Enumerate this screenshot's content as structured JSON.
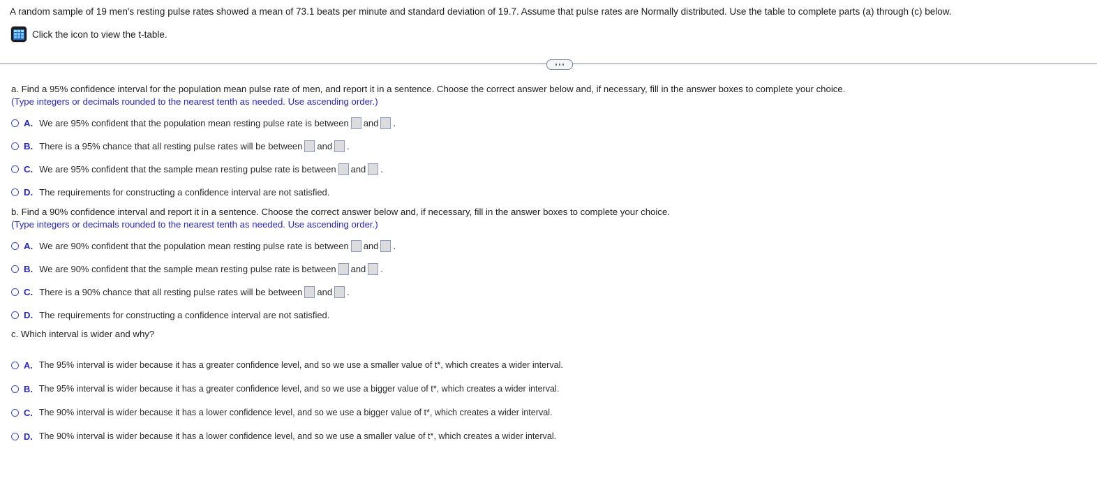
{
  "stem": "A random sample of 19 men's resting pulse rates showed a mean of 73.1 beats per minute and standard deviation of 19.7. Assume that pulse rates are Normally distributed. Use the table to complete parts (a) through (c) below.",
  "ttable": {
    "icon": "table-icon",
    "label": "Click the icon to view the t-table."
  },
  "divider": {
    "icon": "ellipsis-icon"
  },
  "colors": {
    "hint_blue": "#2727c4",
    "letter_blue": "#2727c4",
    "radio_blue": "#3f4fc4",
    "body_text": "#1c1c1c",
    "answer_box_fill": "#dcdcdc",
    "answer_box_border": "#8c9bc6",
    "divider": "#7b849b",
    "icon_blue": "#1769d6"
  },
  "parts": [
    {
      "id": "a",
      "prompt": "a. Find a 95% confidence interval for the population mean pulse rate of men, and report it in a sentence. Choose the correct answer below and, if necessary, fill in the answer boxes to complete your choice.",
      "hint": "(Type integers or decimals rounded to the nearest tenth as needed. Use ascending order.)",
      "options": [
        {
          "letter": "A.",
          "pre": "We are 95% confident that the population mean resting pulse rate is between",
          "mid": "and",
          "post": ".",
          "boxes": 2,
          "box1_value": "",
          "box2_value": ""
        },
        {
          "letter": "B.",
          "pre": "There is a 95% chance that all resting pulse rates will be between",
          "mid": "and",
          "post": ".",
          "boxes": 2,
          "box1_value": "",
          "box2_value": ""
        },
        {
          "letter": "C.",
          "pre": "We are 95% confident that the sample mean resting pulse rate is between",
          "mid": "and",
          "post": ".",
          "boxes": 2,
          "box1_value": "",
          "box2_value": ""
        },
        {
          "letter": "D.",
          "pre": "The requirements for constructing a confidence interval are not satisfied.",
          "mid": "",
          "post": "",
          "boxes": 0,
          "box1_value": "",
          "box2_value": ""
        }
      ]
    },
    {
      "id": "b",
      "prompt": "b. Find a 90% confidence interval and report it in a sentence. Choose the correct answer below and, if necessary, fill in the answer boxes to complete your choice.",
      "hint": "(Type integers or decimals rounded to the nearest tenth as needed. Use ascending order.)",
      "options": [
        {
          "letter": "A.",
          "pre": "We are 90% confident that the population mean resting pulse rate is between",
          "mid": "and",
          "post": ".",
          "boxes": 2,
          "box1_value": "",
          "box2_value": ""
        },
        {
          "letter": "B.",
          "pre": "We are 90% confident that the sample mean resting pulse rate is between",
          "mid": "and",
          "post": ".",
          "boxes": 2,
          "box1_value": "",
          "box2_value": ""
        },
        {
          "letter": "C.",
          "pre": "There is a 90% chance that all resting pulse rates will be between",
          "mid": "and",
          "post": ".",
          "boxes": 2,
          "box1_value": "",
          "box2_value": ""
        },
        {
          "letter": "D.",
          "pre": "The requirements for constructing a confidence interval are not satisfied.",
          "mid": "",
          "post": "",
          "boxes": 0,
          "box1_value": "",
          "box2_value": ""
        }
      ]
    },
    {
      "id": "c",
      "prompt": "c. Which interval is wider and why?",
      "hint": "",
      "options": [
        {
          "letter": "A.",
          "pre": "The 95% interval is wider because it has a greater confidence level, and so we use a smaller value of t*, which creates a wider interval.",
          "mid": "",
          "post": "",
          "boxes": 0,
          "box1_value": "",
          "box2_value": ""
        },
        {
          "letter": "B.",
          "pre": "The 95% interval is wider because it has a greater confidence level, and so we use a bigger value of t*, which creates a wider interval.",
          "mid": "",
          "post": "",
          "boxes": 0,
          "box1_value": "",
          "box2_value": ""
        },
        {
          "letter": "C.",
          "pre": "The 90% interval is wider because it has a lower confidence level, and so we use a bigger value of t*, which creates a wider interval.",
          "mid": "",
          "post": "",
          "boxes": 0,
          "box1_value": "",
          "box2_value": ""
        },
        {
          "letter": "D.",
          "pre": "The 90% interval is wider because it has a lower confidence level, and so we use a smaller value of t*, which creates a wider interval.",
          "mid": "",
          "post": "",
          "boxes": 0,
          "box1_value": "",
          "box2_value": ""
        }
      ]
    }
  ]
}
